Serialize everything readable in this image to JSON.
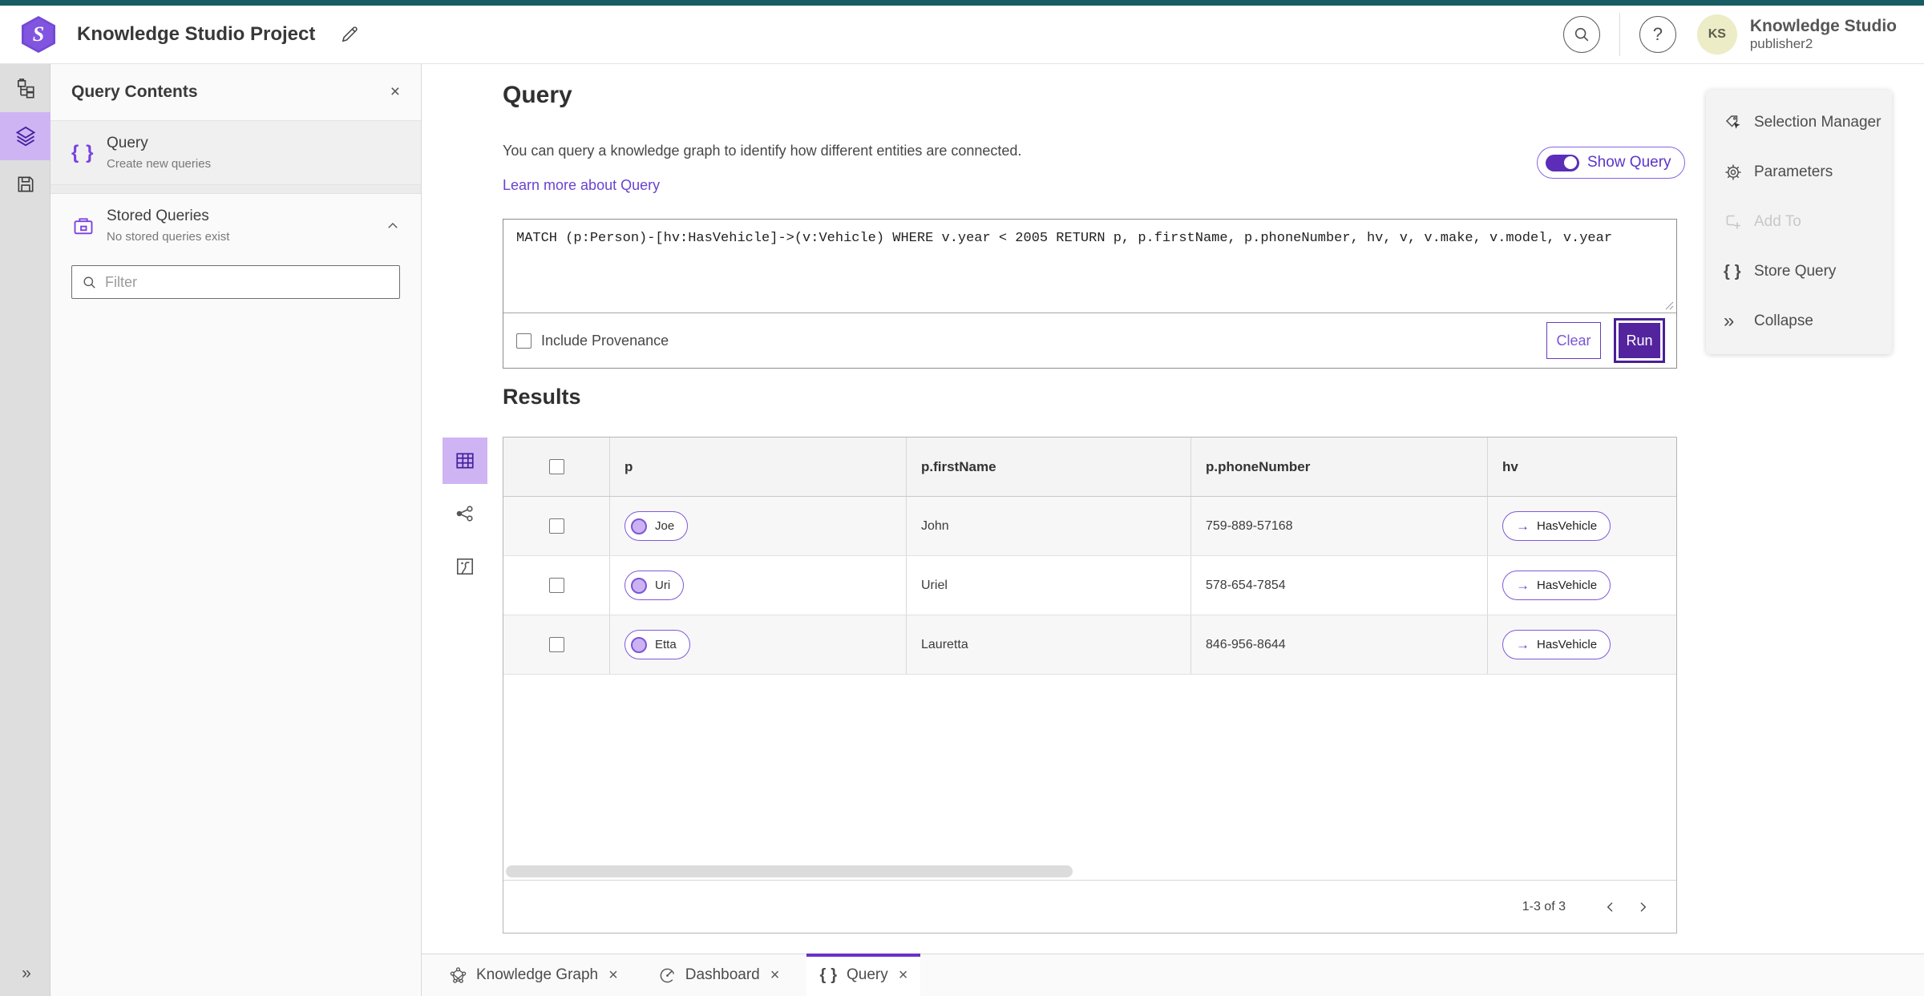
{
  "app": {
    "title": "Knowledge Studio Project",
    "user_name": "Knowledge Studio",
    "user_role": "publisher2",
    "avatar_initials": "KS"
  },
  "left_panel": {
    "title": "Query Contents",
    "query_item": {
      "title": "Query",
      "subtitle": "Create new queries"
    },
    "stored_queries": {
      "title": "Stored Queries",
      "subtitle": "No stored queries exist"
    },
    "filter_placeholder": "Filter"
  },
  "query_section": {
    "title": "Query",
    "description": "You can query a knowledge graph to identify how different entities are connected.",
    "learn_more": "Learn more about Query",
    "show_query_label": "Show Query",
    "query_text": "MATCH (p:Person)-[hv:HasVehicle]->(v:Vehicle) WHERE v.year < 2005 RETURN p, p.firstName, p.phoneNumber, hv, v, v.make, v.model, v.year",
    "include_provenance_label": "Include Provenance",
    "clear_label": "Clear",
    "run_label": "Run"
  },
  "results": {
    "title": "Results",
    "columns": [
      "p",
      "p.firstName",
      "p.phoneNumber",
      "hv"
    ],
    "rows": [
      {
        "p": "Joe",
        "firstName": "John",
        "phoneNumber": "759-889-57168",
        "hv": "HasVehicle",
        "arrow": "→"
      },
      {
        "p": "Uri",
        "firstName": "Uriel",
        "phoneNumber": "578-654-7854",
        "hv": "HasVehicle",
        "arrow": "→"
      },
      {
        "p": "Etta",
        "firstName": "Lauretta",
        "phoneNumber": "846-956-8644",
        "hv": "HasVehicle",
        "arrow": "→"
      }
    ],
    "pagination": "1-3 of 3"
  },
  "tools_panel": {
    "selection_manager": "Selection Manager",
    "parameters": "Parameters",
    "add_to": "Add To",
    "store_query": "Store Query",
    "collapse": "Collapse"
  },
  "tabs": {
    "knowledge_graph": "Knowledge Graph",
    "dashboard": "Dashboard",
    "query": "Query"
  },
  "glyphs": {
    "close": "×",
    "braces": "{ }",
    "chevrons_right": "»",
    "arrow_right": "→"
  },
  "colors": {
    "accent": "#6a3ac2",
    "run_fill": "#54249e",
    "teal_strip": "#175d63",
    "rail_active": "#cfb4f4"
  }
}
